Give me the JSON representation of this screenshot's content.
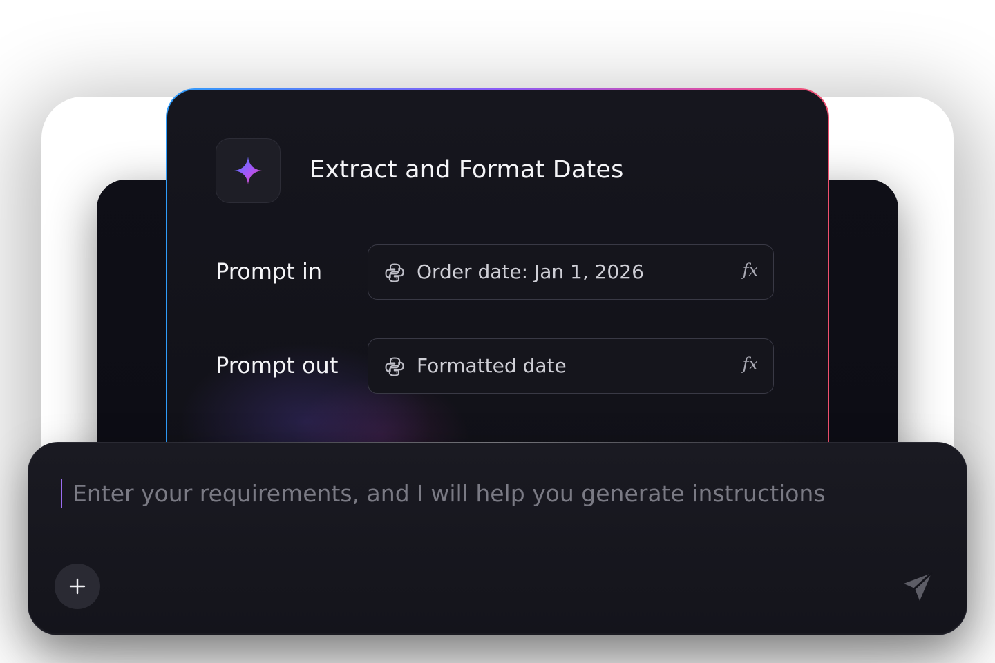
{
  "card": {
    "title": "Extract and Format Dates",
    "icon": "sparkle-icon",
    "accent_colors": [
      "#2f9dfb",
      "#8a5cf6",
      "#e14fa0"
    ]
  },
  "fields": [
    {
      "label": "Prompt in",
      "value": "Order date: Jan 1, 2026",
      "icon": "python-icon",
      "action": "fx"
    },
    {
      "label": "Prompt out",
      "value": "Formatted date",
      "icon": "python-icon",
      "action": "fx"
    }
  ],
  "composer": {
    "placeholder": "Enter your requirements, and I will help you generate instructions",
    "value": "",
    "add_icon": "plus-icon",
    "send_icon": "send-icon"
  }
}
